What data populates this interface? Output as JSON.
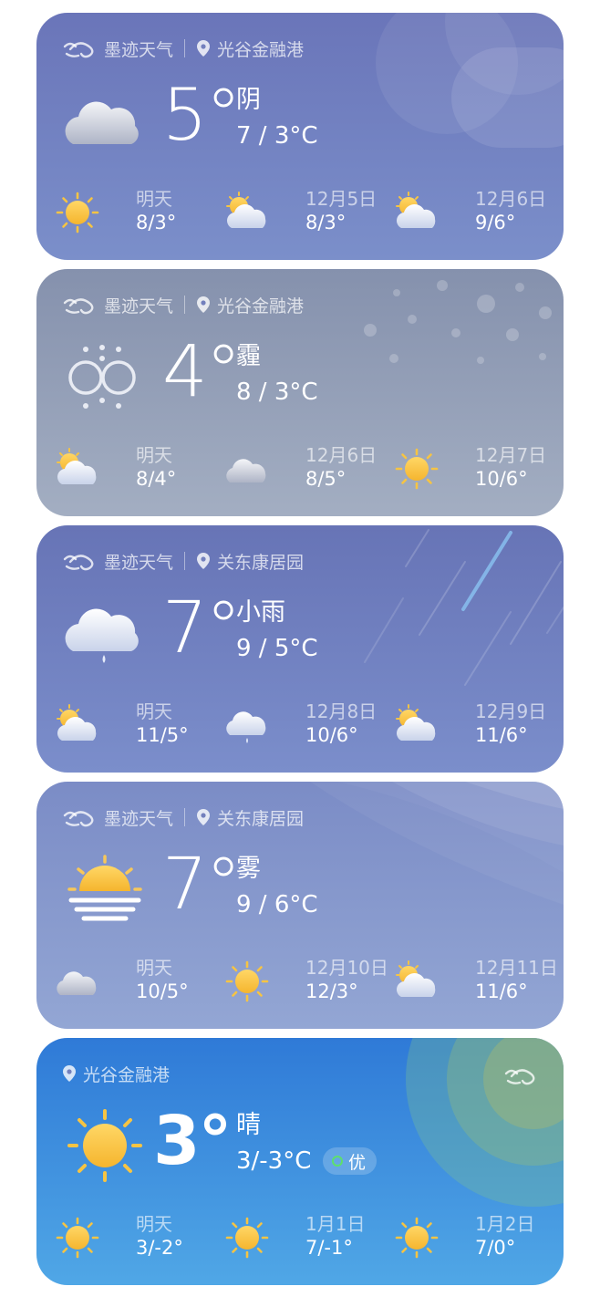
{
  "cards": [
    {
      "brand": "墨迹天气",
      "location": "光谷金融港",
      "temperature": "5°",
      "condition": "阴",
      "range": "7 / 3°C",
      "icon": "cloudy-icon",
      "forecast": [
        {
          "day": "明天",
          "range": "8/3°",
          "icon": "sun-icon"
        },
        {
          "day": "12月5日",
          "range": "8/3°",
          "icon": "partly-cloudy-icon"
        },
        {
          "day": "12月6日",
          "range": "9/6°",
          "icon": "partly-cloudy-icon"
        }
      ]
    },
    {
      "brand": "墨迹天气",
      "location": "光谷金融港",
      "temperature": "4°",
      "condition": "霾",
      "range": "8 / 3°C",
      "icon": "haze-icon",
      "forecast": [
        {
          "day": "明天",
          "range": "8/4°",
          "icon": "partly-cloudy-icon"
        },
        {
          "day": "12月6日",
          "range": "8/5°",
          "icon": "cloudy-icon"
        },
        {
          "day": "12月7日",
          "range": "10/6°",
          "icon": "sun-icon"
        }
      ]
    },
    {
      "brand": "墨迹天气",
      "location": "关东康居园",
      "temperature": "7°",
      "condition": "小雨",
      "range": "9 / 5°C",
      "icon": "light-rain-icon",
      "forecast": [
        {
          "day": "明天",
          "range": "11/5°",
          "icon": "partly-cloudy-icon"
        },
        {
          "day": "12月8日",
          "range": "10/6°",
          "icon": "light-rain-icon"
        },
        {
          "day": "12月9日",
          "range": "11/6°",
          "icon": "partly-cloudy-icon"
        }
      ]
    },
    {
      "brand": "墨迹天气",
      "location": "关东康居园",
      "temperature": "7°",
      "condition": "雾",
      "range": "9 / 6°C",
      "icon": "fog-icon",
      "forecast": [
        {
          "day": "明天",
          "range": "10/5°",
          "icon": "cloudy-icon"
        },
        {
          "day": "12月10日",
          "range": "12/3°",
          "icon": "sun-icon"
        },
        {
          "day": "12月11日",
          "range": "11/6°",
          "icon": "partly-cloudy-icon"
        }
      ]
    },
    {
      "location": "光谷金融港",
      "temperature": "3°",
      "condition": "晴",
      "range": "3/-3°C",
      "aqi": "优",
      "icon": "sun-icon",
      "forecast": [
        {
          "day": "明天",
          "range": "3/-2°",
          "icon": "sun-icon"
        },
        {
          "day": "1月1日",
          "range": "7/-1°",
          "icon": "sun-icon"
        },
        {
          "day": "1月2日",
          "range": "7/0°",
          "icon": "sun-icon"
        }
      ]
    }
  ],
  "colors": {
    "sun": "#f6c443",
    "cloud": "#eef2fb",
    "aqi_good": "#5de06c"
  }
}
